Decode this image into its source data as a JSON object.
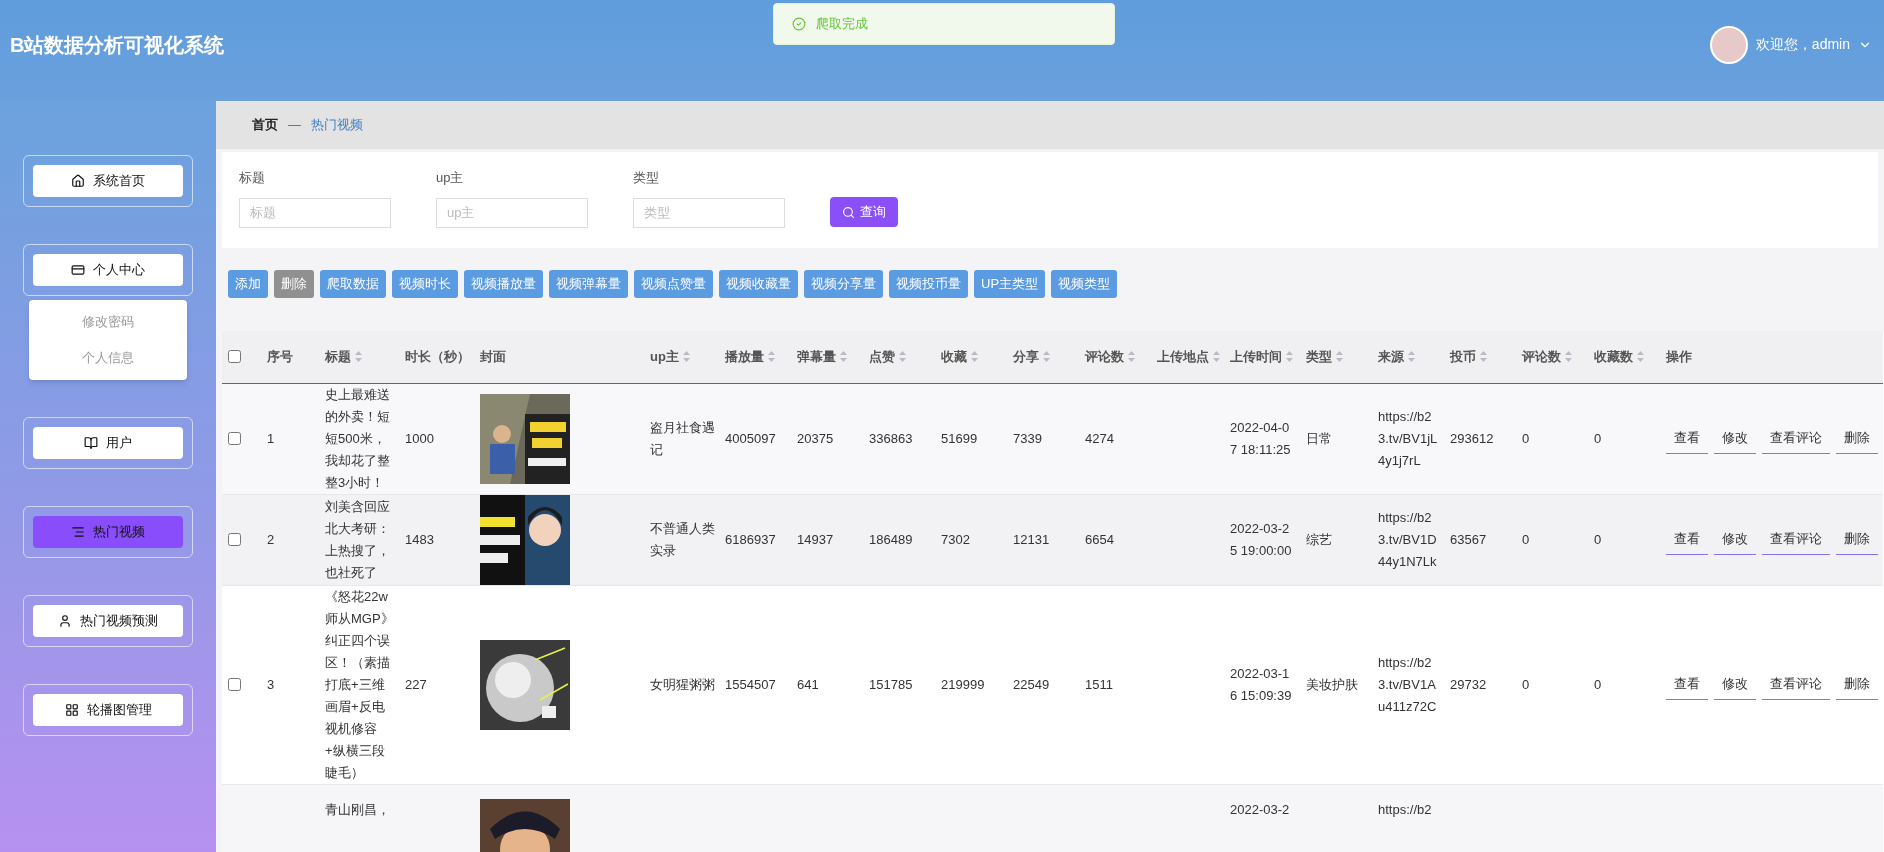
{
  "header": {
    "title": "B站数据分析可视化系统",
    "welcome": "欢迎您，admin"
  },
  "toast": {
    "text": "爬取完成",
    "kind": "success"
  },
  "sidebar": {
    "items": [
      {
        "label": "系统首页",
        "selected": false
      },
      {
        "label": "个人中心",
        "selected": false,
        "children": [
          {
            "label": "修改密码",
            "selected": false
          },
          {
            "label": "个人信息",
            "selected": false
          }
        ]
      },
      {
        "label": "用户",
        "selected": false
      },
      {
        "label": "热门视频",
        "selected": true
      },
      {
        "label": "热门视频预测",
        "selected": false
      },
      {
        "label": "轮播图管理",
        "selected": false
      }
    ]
  },
  "breadcrumb": {
    "home": "首页",
    "separator": "—",
    "current": "热门视频"
  },
  "filters": {
    "fields": [
      {
        "label": "标题",
        "placeholder": "标题"
      },
      {
        "label": "up主",
        "placeholder": "up主"
      },
      {
        "label": "类型",
        "placeholder": "类型"
      }
    ],
    "search_button": "查询"
  },
  "toolbar": [
    {
      "label": "添加",
      "disabled": false
    },
    {
      "label": "删除",
      "disabled": true
    },
    {
      "label": "爬取数据",
      "disabled": false
    },
    {
      "label": "视频时长",
      "disabled": false
    },
    {
      "label": "视频播放量",
      "disabled": false
    },
    {
      "label": "视频弹幕量",
      "disabled": false
    },
    {
      "label": "视频点赞量",
      "disabled": false
    },
    {
      "label": "视频收藏量",
      "disabled": false
    },
    {
      "label": "视频分享量",
      "disabled": false
    },
    {
      "label": "视频投币量",
      "disabled": false
    },
    {
      "label": "UP主类型",
      "disabled": false
    },
    {
      "label": "视频类型",
      "disabled": false
    }
  ],
  "table": {
    "header_checkbox": {
      "checked": false
    },
    "columns": [
      {
        "label": "序号",
        "sortable": false
      },
      {
        "label": "标题",
        "sortable": true
      },
      {
        "label": "时长（秒）",
        "sortable": false
      },
      {
        "label": "封面",
        "sortable": false
      },
      {
        "label": "up主",
        "sortable": true
      },
      {
        "label": "播放量",
        "sortable": true
      },
      {
        "label": "弹幕量",
        "sortable": true
      },
      {
        "label": "点赞",
        "sortable": true
      },
      {
        "label": "收藏",
        "sortable": true
      },
      {
        "label": "分享",
        "sortable": true
      },
      {
        "label": "评论数",
        "sortable": true
      },
      {
        "label": "上传地点",
        "sortable": true
      },
      {
        "label": "上传时间",
        "sortable": true
      },
      {
        "label": "类型",
        "sortable": true
      },
      {
        "label": "来源",
        "sortable": true
      },
      {
        "label": "投币",
        "sortable": true
      },
      {
        "label": "评论数",
        "sortable": true
      },
      {
        "label": "收藏数",
        "sortable": true
      },
      {
        "label": "操作",
        "sortable": false
      }
    ],
    "rows": [
      {
        "checked": false,
        "index": "1",
        "title": "史上最难送的外卖！短短500米，我却花了整整3小时！",
        "duration": "1000",
        "up": "盗月社食遇记",
        "plays": "4005097",
        "danmaku": "20375",
        "likes": "336863",
        "favorites": "51699",
        "shares": "7339",
        "comments": "4274",
        "upload_time": "2022-04-07 18:11:25",
        "type": "日常",
        "source": "https://b23.tv/BV1jL4y1j7rL",
        "coins": "293612",
        "comment_count": "0",
        "favorite_count": "0",
        "actions": [
          "查看",
          "修改",
          "查看评论",
          "删除"
        ]
      },
      {
        "checked": false,
        "index": "2",
        "title": "刘美含回应北大考研：上热搜了，也社死了",
        "duration": "1483",
        "up": "不普通人类实录",
        "plays": "6186937",
        "danmaku": "14937",
        "likes": "186489",
        "favorites": "7302",
        "shares": "12131",
        "comments": "6654",
        "upload_time": "2022-03-25 19:00:00",
        "type": "综艺",
        "source": "https://b23.tv/BV1D44y1N7Lk",
        "coins": "63567",
        "comment_count": "0",
        "favorite_count": "0",
        "actions": [
          "查看",
          "修改",
          "查看评论",
          "删除"
        ]
      },
      {
        "checked": false,
        "index": "3",
        "title": "《怒花22w师从MGP》纠正四个误区！（素描打底+三维画眉+反电视机修容+纵横三段睫毛）",
        "duration": "227",
        "up": "女明猩粥粥",
        "plays": "1554507",
        "danmaku": "641",
        "likes": "151785",
        "favorites": "219999",
        "shares": "22549",
        "comments": "1511",
        "upload_time": "2022-03-16 15:09:39",
        "type": "美妆护肤",
        "source": "https://b23.tv/BV1Au411z72C",
        "coins": "29732",
        "comment_count": "0",
        "favorite_count": "0",
        "actions": [
          "查看",
          "修改",
          "查看评论",
          "删除"
        ]
      },
      {
        "title": "青山刚昌，",
        "upload_time": "2022-03-2",
        "source": "https://b2"
      }
    ]
  }
}
